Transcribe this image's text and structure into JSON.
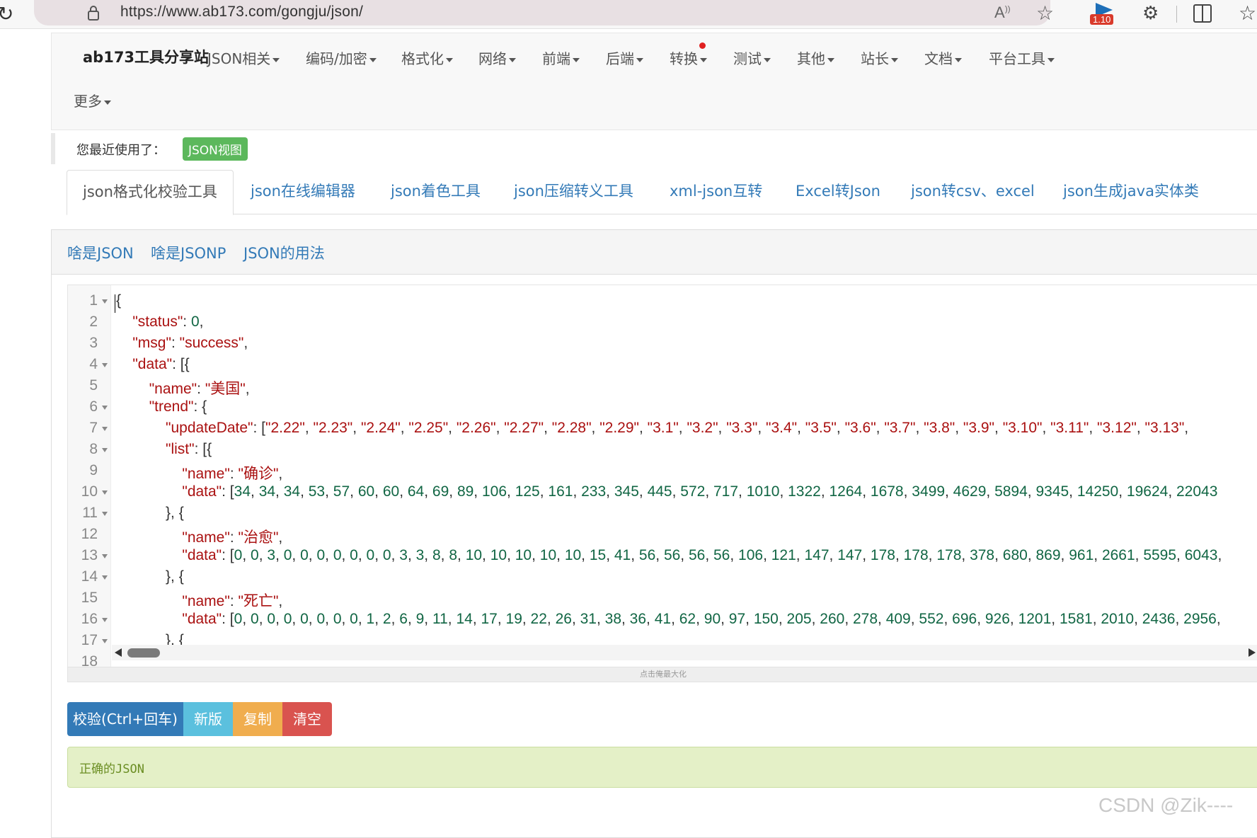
{
  "browser": {
    "url": "https://www.ab173.com/gongju/json/",
    "read_aloud": "Ă",
    "extension_badge": "1.10"
  },
  "navbar": {
    "brand": "ab173工具分享站",
    "items": [
      "JSON相关",
      "编码/加密",
      "格式化",
      "网络",
      "前端",
      "后端",
      "转换",
      "测试",
      "其他",
      "站长",
      "文档",
      "平台工具",
      "更多"
    ]
  },
  "recent": {
    "label": "您最近使用了：",
    "badge": "JSON视图"
  },
  "tabs": [
    "json格式化校验工具",
    "json在线编辑器",
    "json着色工具",
    "json压缩转义工具",
    "xml-json互转",
    "Excel转Json",
    "json转csv、excel",
    "json生成java实体类"
  ],
  "panel_links": [
    "啥是JSON",
    "啥是JSONP",
    "JSON的用法"
  ],
  "editor": {
    "line_numbers": [
      "1",
      "2",
      "3",
      "4",
      "5",
      "6",
      "7",
      "8",
      "9",
      "10",
      "11",
      "12",
      "13",
      "14",
      "15",
      "16",
      "17",
      "18"
    ],
    "lines": [
      "{",
      "    \"status\": 0,",
      "    \"msg\": \"success\",",
      "    \"data\": [{",
      "        \"name\": \"美国\",",
      "        \"trend\": {",
      "            \"updateDate\": [\"2.22\", \"2.23\", \"2.24\", \"2.25\", \"2.26\", \"2.27\", \"2.28\", \"2.29\", \"3.1\", \"3.2\", \"3.3\", \"3.4\", \"3.5\", \"3.6\", \"3.7\", \"3.8\", \"3.9\", \"3.10\", \"3.11\", \"3.12\", \"3.13\",",
      "            \"list\": [{",
      "                \"name\": \"确诊\",",
      "                \"data\": [34, 34, 34, 53, 57, 60, 60, 64, 69, 89, 106, 125, 161, 233, 345, 445, 572, 717, 1010, 1322, 1264, 1678, 3499, 4629, 5894, 9345, 14250, 19624, 22043",
      "            }, {",
      "                \"name\": \"治愈\",",
      "                \"data\": [0, 0, 3, 0, 0, 0, 0, 0, 0, 0, 3, 3, 8, 8, 10, 10, 10, 10, 10, 15, 41, 56, 56, 56, 56, 106, 121, 147, 147, 178, 178, 178, 378, 680, 869, 961, 2661, 5595, 6043,",
      "            }, {",
      "                \"name\": \"死亡\",",
      "                \"data\": [0, 0, 0, 0, 0, 0, 0, 0, 1, 2, 6, 9, 11, 14, 17, 19, 22, 26, 31, 38, 36, 41, 62, 90, 97, 150, 205, 260, 278, 409, 552, 696, 926, 1201, 1581, 2010, 2436, 2956,",
      "            }, {",
      ""
    ],
    "maximize_hint": "点击俺最大化"
  },
  "buttons": {
    "validate": "校验(Ctrl+回车)",
    "new_version": "新版",
    "copy": "复制",
    "clear": "清空"
  },
  "result": "正确的JSON",
  "watermark": "CSDN @Zik----"
}
